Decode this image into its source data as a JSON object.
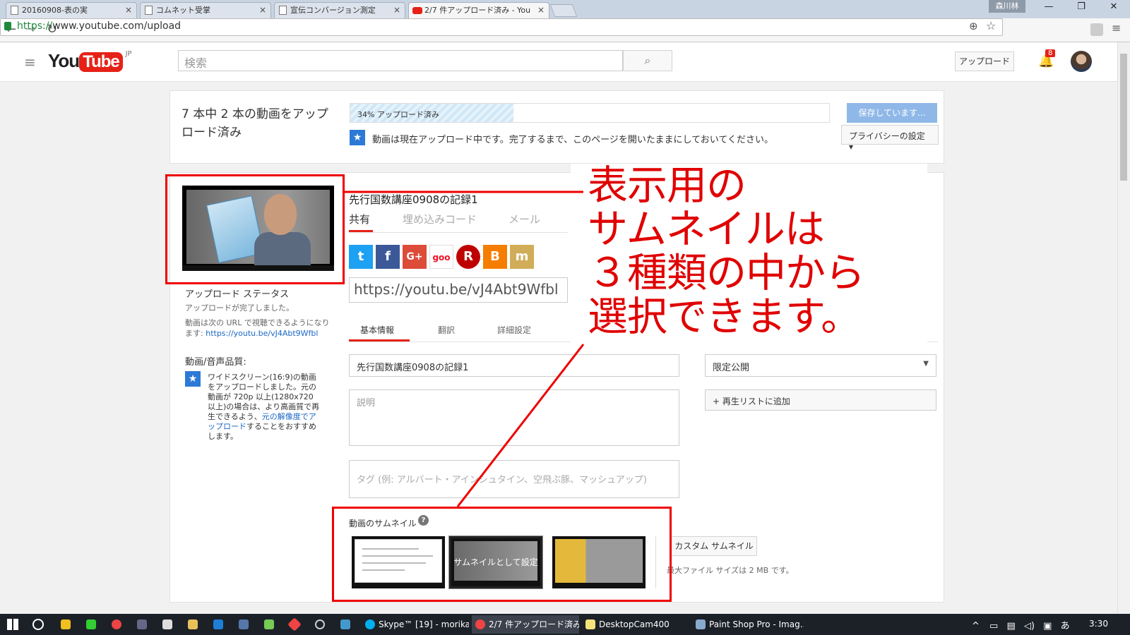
{
  "browser": {
    "tabs": [
      {
        "title": "20160908-表の実"
      },
      {
        "title": "コムネット受掌"
      },
      {
        "title": "宣伝コンバージョン測定"
      },
      {
        "title": "2/7 件アップロード済み - You"
      }
    ],
    "close_glyph": "×",
    "user_badge": "森川林",
    "url_scheme": "https://",
    "url_rest": "www.youtube.com/upload",
    "window_controls": {
      "minimize": "—",
      "restore": "❐",
      "close": "✕"
    }
  },
  "youtube": {
    "logo_you": "You",
    "logo_tube": "Tube",
    "logo_region": "JP",
    "search_placeholder": "検索",
    "upload_button": "アップロード",
    "notification_count": "8"
  },
  "upload_progress": {
    "title": "7 本中 2 本の動画をアップロード済み",
    "progress_text": "34% アップロード済み",
    "progress_percent": 34,
    "saving_button": "保存しています...",
    "note": "動画は現在アップロード中です。完了するまで、このページを開いたままにしておいてください。",
    "privacy_button": "プライバシーの設定 ▾"
  },
  "sidebar": {
    "status_heading": "アップロード ステータス",
    "status_line": "アップロードが完了しました。",
    "url_text": "動画は次の URL で視聴できるようになります:",
    "url_link": "https://youtu.be/vJ4Abt9Wfbl",
    "quality_heading": "動画/音声品質:",
    "quality_text_1": "ワイドスクリーン(16:9)の動画をアップロードしました。元の動画が 720p 以上(1280x720 以上)の場合は、より高画質で再生できるよう、",
    "quality_link": "元の解像度でアップロード",
    "quality_text_2": "することをおすすめします。"
  },
  "video": {
    "title": "先行国数講座0908の記録1",
    "share_tabs": [
      "共有",
      "埋め込みコード",
      "メール"
    ],
    "social": [
      {
        "name": "twitter",
        "glyph": "t",
        "color": "#1da1f2"
      },
      {
        "name": "facebook",
        "glyph": "f",
        "color": "#3b5998"
      },
      {
        "name": "google-plus",
        "glyph": "G+",
        "color": "#dd4b39"
      },
      {
        "name": "goo",
        "glyph": "goo",
        "color": "#ffffff"
      },
      {
        "name": "rakuten",
        "glyph": "R",
        "color": "#bf0000"
      },
      {
        "name": "blogger",
        "glyph": "B",
        "color": "#f57d00"
      },
      {
        "name": "mixi",
        "glyph": "m",
        "color": "#d1ad59"
      }
    ],
    "share_url": "https://youtu.be/vJ4Abt9Wfbl",
    "info_tabs": [
      "基本情報",
      "翻訳",
      "詳細設定"
    ],
    "title_value": "先行国数講座0908の記録1",
    "description_placeholder": "説明",
    "tags_placeholder": "タグ (例: アルバート・アインシュタイン、空飛ぶ豚、マッシュアップ)",
    "visibility": "限定公開",
    "playlist_button": "+ 再生リストに追加",
    "thumbnail_label": "動画のサムネイル",
    "thumbnail_hover": "サムネイルとして設定",
    "custom_thumbnail_button": "カスタム サムネイル",
    "max_size_note": "最大ファイル サイズは 2 MB です。"
  },
  "annotation": {
    "lines": [
      "表示用の",
      "サムネイルは",
      "３種類の中から",
      "選択できます。"
    ],
    "color": "#e00000"
  },
  "taskbar": {
    "tasks": [
      {
        "label": "Skype™ [19] - morika..."
      },
      {
        "label": "2/7 件アップロード済み -..."
      },
      {
        "label": "DesktopCam400"
      },
      {
        "label": "Paint Shop Pro - Imag..."
      }
    ],
    "tray_ime": "あ",
    "clock": "3:30"
  }
}
